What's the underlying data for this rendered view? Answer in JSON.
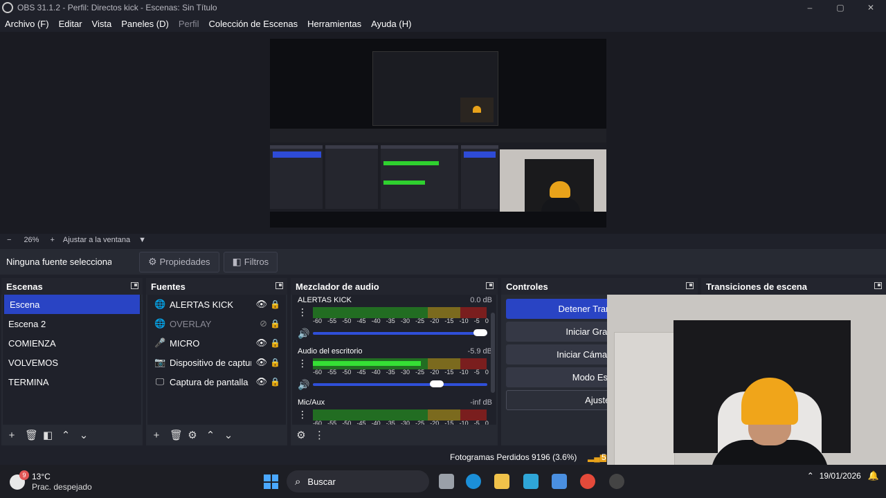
{
  "window": {
    "title": "OBS 31.1.2 - Perfil: Directos kick - Escenas: Sin Título",
    "minimize": "–",
    "maximize": "▢",
    "close": "✕"
  },
  "menu": {
    "items": [
      {
        "label": "Archivo (F)",
        "disabled": false
      },
      {
        "label": "Editar",
        "disabled": false
      },
      {
        "label": "Vista",
        "disabled": false
      },
      {
        "label": "Paneles (D)",
        "disabled": false
      },
      {
        "label": "Perfil",
        "disabled": true
      },
      {
        "label": "Colección de Escenas",
        "disabled": false
      },
      {
        "label": "Herramientas",
        "disabled": false
      },
      {
        "label": "Ayuda (H)",
        "disabled": false
      }
    ]
  },
  "zoom": {
    "minus": "−",
    "value": "26%",
    "plus": "+",
    "fit_label": "Ajustar a la ventana",
    "dropdown": "▼"
  },
  "source_bar": {
    "no_selection": "Ninguna fuente seleccionada",
    "properties": "Propiedades",
    "filters": "Filtros"
  },
  "scenes": {
    "title": "Escenas",
    "items": [
      "Escena",
      "Escena 2",
      "COMIENZA",
      "VOLVEMOS",
      "TERMINA"
    ],
    "active_index": 0
  },
  "sources": {
    "title": "Fuentes",
    "items": [
      {
        "label": "ALERTAS KICK",
        "icon": "globe-icon",
        "glyph": "🌐",
        "visible": true,
        "locked": false
      },
      {
        "label": "OVERLAY",
        "icon": "globe-icon",
        "glyph": "🌐",
        "visible": false,
        "locked": true
      },
      {
        "label": "MICRO",
        "icon": "microphone-icon",
        "glyph": "🎤",
        "visible": true,
        "locked": false
      },
      {
        "label": "Dispositivo de captura de vídeo",
        "icon": "camera-icon",
        "glyph": "📷",
        "visible": true,
        "locked": false
      },
      {
        "label": "Captura de pantalla",
        "icon": "monitor-icon",
        "glyph": "🖵",
        "visible": true,
        "locked": false
      }
    ]
  },
  "mixer": {
    "title": "Mezclador de audio",
    "ticks": [
      "-60",
      "-55",
      "-50",
      "-45",
      "-40",
      "-35",
      "-30",
      "-25",
      "-20",
      "-15",
      "-10",
      "-5",
      "0"
    ],
    "channels": [
      {
        "name": "ALERTAS KICK",
        "db": "0.0 dB",
        "level": 0.0,
        "volume": 1.0
      },
      {
        "name": "Audio del escritorio",
        "db": "-5.9 dB",
        "level": 0.62,
        "volume": 0.73
      },
      {
        "name": "Mic/Aux",
        "db": "-inf dB",
        "level": 0.0,
        "volume": null
      }
    ]
  },
  "controls": {
    "title": "Controles",
    "buttons": [
      "Detener Transmisión",
      "Iniciar Grabación",
      "Iniciar Cámara Virtual",
      "Modo Estudio",
      "Ajustes"
    ]
  },
  "transitions": {
    "title": "Transiciones de escena"
  },
  "status": {
    "dropped_frames": "Fotogramas Perdidos 9196 (3.6%)",
    "extra": "5"
  },
  "taskbar": {
    "weather_badge": "9",
    "temperature": "13°C",
    "condition": "Prac. despejado",
    "search_label": "Buscar",
    "date": "19/01/2026"
  },
  "colors": {
    "accent": "#2944c4",
    "meter_green": "#35e035",
    "warning_orange": "#e8a21a"
  }
}
